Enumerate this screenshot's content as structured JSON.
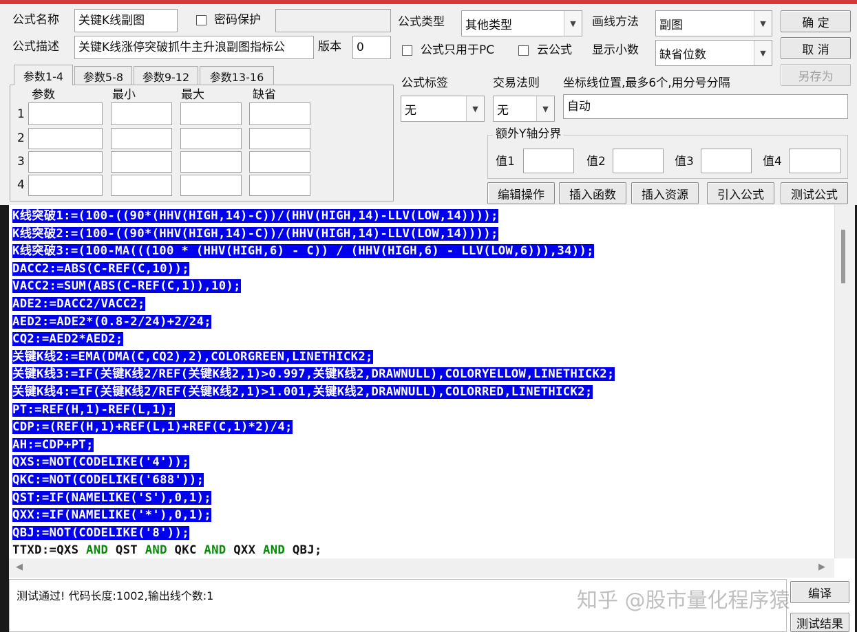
{
  "form": {
    "name_label": "公式名称",
    "name_value": "关键K线副图",
    "password_label": "密码保护",
    "password_value": "",
    "desc_label": "公式描述",
    "desc_value": "关键K线涨停突破抓牛主升浪副图指标公",
    "version_label": "版本",
    "version_value": "0",
    "type_label": "公式类型",
    "type_value": "其他类型",
    "draw_label": "画线方法",
    "draw_value": "副图",
    "pc_only_label": "公式只用于PC",
    "cloud_label": "云公式",
    "decimals_label": "显示小数",
    "decimals_value": "缺省位数",
    "tag_label": "公式标签",
    "tag_value": "无",
    "trade_label": "交易法则",
    "trade_value": "无",
    "coord_label": "坐标线位置,最多6个,用分号分隔",
    "coord_value": "自动",
    "extra_group_label": "额外Y轴分界",
    "val1_label": "值1",
    "val2_label": "值2",
    "val3_label": "值3",
    "val4_label": "值4"
  },
  "buttons": {
    "ok": "确 定",
    "cancel": "取 消",
    "save_as": "另存为",
    "edit_ops": "编辑操作",
    "insert_func": "插入函数",
    "insert_res": "插入资源",
    "import_formula": "引入公式",
    "test_formula": "测试公式",
    "compile": "编译",
    "test_result": "测试结果"
  },
  "tabs": [
    "参数1-4",
    "参数5-8",
    "参数9-12",
    "参数13-16"
  ],
  "params": {
    "headers": [
      "参数",
      "最小",
      "最大",
      "缺省"
    ],
    "rows": [
      "1",
      "2",
      "3",
      "4"
    ]
  },
  "code_lines": [
    "K线突破1:=(100-((90*(HHV(HIGH,14)-C))/(HHV(HIGH,14)-LLV(LOW,14))));",
    "K线突破2:=(100-((90*(HHV(HIGH,14)-C))/(HHV(HIGH,14)-LLV(LOW,14))));",
    "K线突破3:=(100-MA(((100 * (HHV(HIGH,6) - C)) / (HHV(HIGH,6) - LLV(LOW,6))),34));",
    "DACC2:=ABS(C-REF(C,10));",
    "VACC2:=SUM(ABS(C-REF(C,1)),10);",
    "ADE2:=DACC2/VACC2;",
    "AED2:=ADE2*(0.8-2/24)+2/24;",
    "CQ2:=AED2*AED2;",
    "关键K线2:=EMA(DMA(C,CQ2),2),COLORGREEN,LINETHICK2;",
    "关键K线3:=IF(关键K线2/REF(关键K线2,1)>0.997,关键K线2,DRAWNULL),COLORYELLOW,LINETHICK2;",
    "关键K线4:=IF(关键K线2/REF(关键K线2,1)>1.001,关键K线2,DRAWNULL),COLORRED,LINETHICK2;",
    "PT:=REF(H,1)-REF(L,1);",
    "CDP:=(REF(H,1)+REF(L,1)+REF(C,1)*2)/4;",
    "AH:=CDP+PT;",
    "QXS:=NOT(CODELIKE('4'));",
    "QKC:=NOT(CODELIKE('688'));",
    "QST:=IF(NAMELIKE('S'),0,1);",
    "QXX:=IF(NAMELIKE('*'),0,1);",
    "QBJ:=NOT(CODELIKE('8'));"
  ],
  "last_line": {
    "parts": [
      "TTXD:=QXS ",
      "AND",
      " QST ",
      "AND",
      " QKC ",
      "AND",
      " QXX ",
      "AND",
      " QBJ;"
    ]
  },
  "status": {
    "text": "测试通过! 代码长度:1002,输出线个数:1"
  },
  "watermark": "知乎 @股市量化程序猿",
  "colors": {
    "selection": "#0000ee",
    "keyword": "#0a8a0a",
    "title_bar": "#d33a3a"
  }
}
